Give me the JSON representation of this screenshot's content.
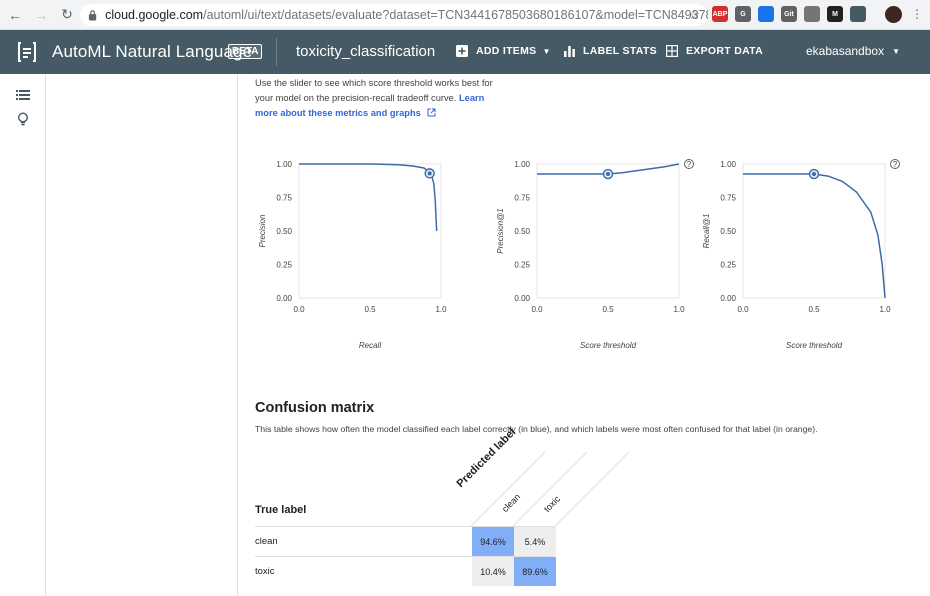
{
  "browser": {
    "url_host": "cloud.google.com",
    "url_path": "/automl/ui/text/datasets/evaluate?dataset=TCN3441678503680186107&model=TCN84937828975...",
    "extensions": [
      {
        "name": "adblock-icon",
        "label": "ABP",
        "color": "#d32f2f"
      },
      {
        "name": "g-icon",
        "label": "G",
        "color": "#5f6368"
      },
      {
        "name": "shield-icon",
        "label": "",
        "color": "#1a73e8"
      },
      {
        "name": "gitzip-icon",
        "label": "Git",
        "color": "#616161"
      },
      {
        "name": "picture-icon",
        "label": "",
        "color": "#757575"
      },
      {
        "name": "m-icon",
        "label": "M",
        "color": "#212121"
      },
      {
        "name": "box-icon",
        "label": "",
        "color": "#455a64"
      }
    ]
  },
  "appbar": {
    "title": "AutoML Natural Language",
    "badge": "BETA",
    "dataset": "toxicity_classification",
    "add_items": "ADD ITEMS",
    "label_stats": "LABEL STATS",
    "export_data": "EXPORT DATA",
    "account": "ekabasandbox"
  },
  "description": {
    "text": "Use the slider to see which score threshold works best for your model on the precision-recall tradeoff curve.",
    "link": "Learn more about these metrics and graphs"
  },
  "chart_data": [
    {
      "type": "line",
      "xlabel": "Recall",
      "ylabel": "Precision",
      "xlim": [
        0,
        1
      ],
      "ylim": [
        0,
        1
      ],
      "x_ticks": [
        "0.0",
        "0.5",
        "1.0"
      ],
      "y_ticks": [
        "1.00",
        "0.75",
        "0.50",
        "0.25",
        "0.00"
      ],
      "x": [
        0.0,
        0.3,
        0.5,
        0.7,
        0.8,
        0.88,
        0.93,
        0.95,
        0.96,
        0.965,
        0.97
      ],
      "y": [
        1.0,
        1.0,
        1.0,
        0.995,
        0.985,
        0.97,
        0.93,
        0.85,
        0.72,
        0.6,
        0.5
      ],
      "marker": {
        "x": 0.92,
        "y": 0.93
      },
      "help": false
    },
    {
      "type": "line",
      "xlabel": "Score threshold",
      "ylabel": "Precision@1",
      "xlim": [
        0,
        1
      ],
      "ylim": [
        0,
        1
      ],
      "x_ticks": [
        "0.0",
        "0.5",
        "1.0"
      ],
      "y_ticks": [
        "1.00",
        "0.75",
        "0.50",
        "0.25",
        "0.00"
      ],
      "x": [
        0.0,
        0.2,
        0.4,
        0.5,
        0.6,
        0.7,
        0.8,
        0.9,
        1.0
      ],
      "y": [
        0.925,
        0.925,
        0.925,
        0.925,
        0.935,
        0.95,
        0.965,
        0.98,
        1.0
      ],
      "marker": {
        "x": 0.5,
        "y": 0.925
      },
      "help": true
    },
    {
      "type": "line",
      "xlabel": "Score threshold",
      "ylabel": "Recall@1",
      "xlim": [
        0,
        1
      ],
      "ylim": [
        0,
        1
      ],
      "x_ticks": [
        "0.0",
        "0.5",
        "1.0"
      ],
      "y_ticks": [
        "1.00",
        "0.75",
        "0.50",
        "0.25",
        "0.00"
      ],
      "x": [
        0.0,
        0.3,
        0.5,
        0.6,
        0.7,
        0.8,
        0.9,
        0.95,
        0.98,
        1.0
      ],
      "y": [
        0.925,
        0.925,
        0.925,
        0.91,
        0.87,
        0.79,
        0.64,
        0.47,
        0.25,
        0.0
      ],
      "marker": {
        "x": 0.5,
        "y": 0.925
      },
      "help": true
    }
  ],
  "confusion": {
    "title": "Confusion matrix",
    "description": "This table shows how often the model classified each label correctly (in blue), and which labels were most often confused for that label (in orange).",
    "true_label": "True label",
    "predicted_label": "Predicted label",
    "columns": [
      "clean",
      "toxic"
    ],
    "rows": [
      {
        "label": "clean",
        "cells": [
          "94.6%",
          "5.4%"
        ],
        "correct": 0
      },
      {
        "label": "toxic",
        "cells": [
          "10.4%",
          "89.6%"
        ],
        "correct": 1
      }
    ],
    "colors": {
      "correct": "#82aef7",
      "other": "#eeeeee"
    }
  }
}
